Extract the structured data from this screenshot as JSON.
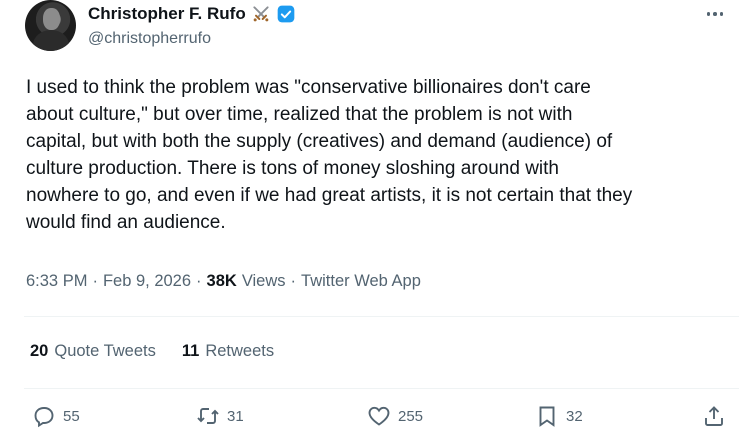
{
  "author": {
    "display_name": "Christopher F. Rufo",
    "handle": "@christopherrufo",
    "badge_icon": "crossed-swords-icon",
    "verified_color": "#1d9bf0"
  },
  "tweet": {
    "text": "I used to think the problem was \"conservative billionaires don't care\nabout culture,\" but over time, realized that the problem is not with\ncapital, but with both the supply (creatives) and demand (audience) of\nculture production. There is tons of money sloshing around with\nnowhere to go, and even if we had great artists, it is not certain that they\nwould find an audience."
  },
  "meta": {
    "time": "6:33 PM",
    "date": "Feb 9, 2026",
    "views_count": "38K",
    "views_label": "Views",
    "source": "Twitter Web App",
    "separator": "·"
  },
  "stats": {
    "quote_count": "20",
    "quote_label": "Quote Tweets",
    "retweet_count": "11",
    "retweet_label": "Retweets"
  },
  "actions": {
    "replies": "55",
    "retweets": "31",
    "likes": "255",
    "bookmarks": "32"
  },
  "colors": {
    "text_primary": "#0f1419",
    "text_secondary": "#536471",
    "divider": "#eff3f4"
  }
}
